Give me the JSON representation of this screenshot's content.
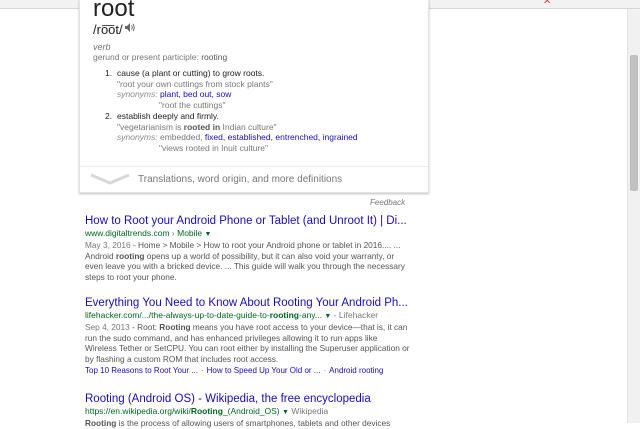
{
  "dictionary": {
    "word": "root",
    "pronunciation": "/ro͞ot/",
    "part_of_speech": "verb",
    "participle_label": "gerund or present participle:",
    "participle": "rooting",
    "definitions": [
      {
        "number": "1.",
        "text": "cause (a plant or cutting) to grow roots.",
        "example": "\"root your own cuttings from stock plants\"",
        "synonyms_label": "synonyms:",
        "synonyms": [
          "plant,",
          "bed out,",
          "sow"
        ],
        "synonym_example": "\"root the cuttings\""
      },
      {
        "number": "2.",
        "text": "establish deeply and firmly.",
        "example_pre": "\"vegetarianism is ",
        "example_bold": "rooted in",
        "example_post": " Indian culture\"",
        "synonyms_label": "synonyms:",
        "synonym_plain": "embedded,",
        "synonyms": [
          "fixed,",
          "established,",
          "entrenched,",
          "ingrained"
        ],
        "synonym_example": "\"views rooted in Inuit culture\""
      }
    ],
    "more": "Translations, word origin, and more definitions"
  },
  "feedback": "Feedback",
  "results": [
    {
      "title": "How to Root your Android Phone or Tablet (and Unroot It) | Di...",
      "url": "www.digitaltrends.com",
      "url_sep": " › ",
      "url_path": "Mobile",
      "snippet_date": "May 3, 2016",
      "snippet_1": " - Home > Mobile > How to root your Android phone or tablet in 2016.... ... Android ",
      "snippet_bold": "rooting",
      "snippet_2": " opens up a world of possibility, but it can also void your warranty, or even leave you with a bricked device. ... This guide will walk you through the necessary steps to root your phone."
    },
    {
      "title": "Everything You Need to Know About Rooting Your Android Ph...",
      "url_pre": "lifehacker.com/.../the-always-up-to-date-guide-to-",
      "url_bold": "rooting",
      "url_post": "-any...",
      "url_extra": "Lifehacker",
      "snippet_date": "Sep 4, 2013",
      "snippet_1": " - Root: ",
      "snippet_bold": "Rooting",
      "snippet_2": " means you have root access to your device—that is, it can run the sudo command, and has enhanced privileges allowing it to run apps like Wireless Tether or SetCPU. You can root either by installing the Superuser application or by flashing a custom ROM that includes root access.",
      "sitelinks": [
        "Top 10 Reasons to Root Your ...",
        "How to Speed Up Your Old or ...",
        "Android rooting"
      ]
    },
    {
      "title": "Rooting (Android OS) - Wikipedia, the free encyclopedia",
      "url_pre": "https://en.wikipedia.org/wiki/",
      "url_bold": "Rooting",
      "url_post": "_(Android_OS)",
      "url_extra": "Wikipedia",
      "snippet_bold": "Rooting",
      "snippet_2": " is the process of allowing users of smartphones, tablets and other devices"
    }
  ],
  "window": {
    "close_glyph": "✕"
  }
}
